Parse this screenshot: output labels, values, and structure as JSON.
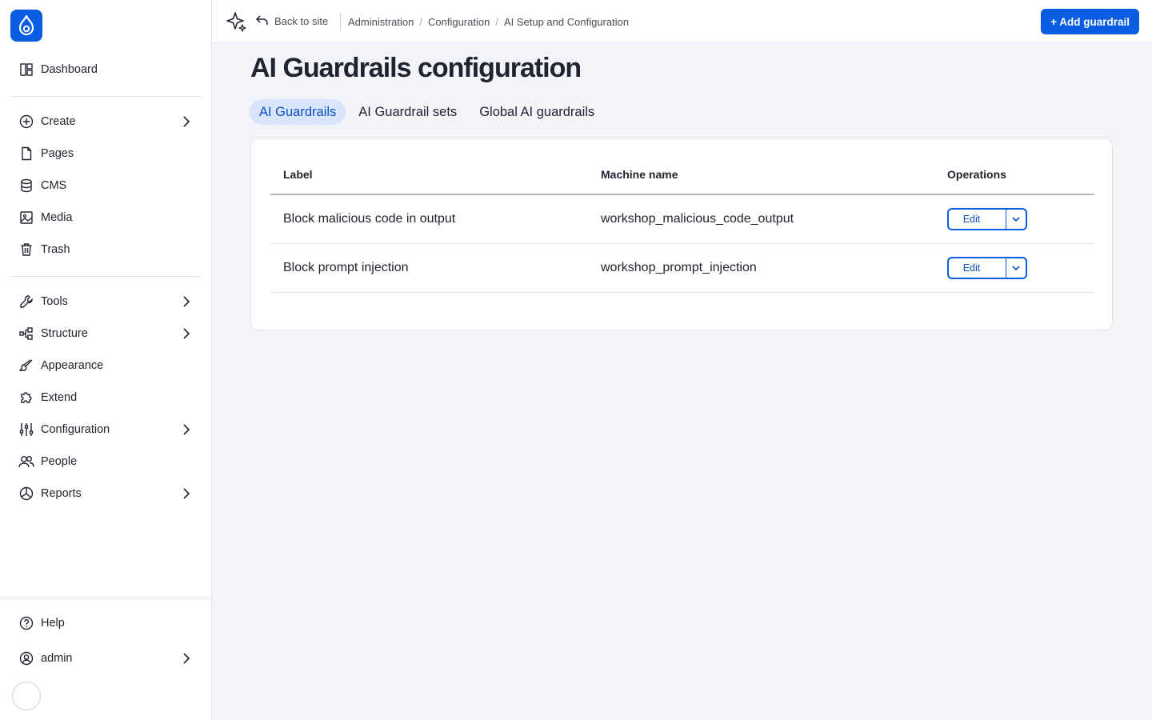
{
  "sidebar": {
    "top": [
      {
        "label": "Dashboard",
        "icon": "dashboard-icon"
      }
    ],
    "content": [
      {
        "label": "Create",
        "icon": "plus-circle-icon",
        "submenu": true
      },
      {
        "label": "Pages",
        "icon": "page-icon",
        "submenu": false
      },
      {
        "label": "CMS",
        "icon": "database-icon",
        "submenu": false
      },
      {
        "label": "Media",
        "icon": "image-icon",
        "submenu": false
      },
      {
        "label": "Trash",
        "icon": "trash-icon",
        "submenu": false
      }
    ],
    "admin": [
      {
        "label": "Tools",
        "icon": "wrench-icon",
        "submenu": true
      },
      {
        "label": "Structure",
        "icon": "structure-icon",
        "submenu": true
      },
      {
        "label": "Appearance",
        "icon": "brush-icon",
        "submenu": false
      },
      {
        "label": "Extend",
        "icon": "puzzle-icon",
        "submenu": false
      },
      {
        "label": "Configuration",
        "icon": "sliders-icon",
        "submenu": true
      },
      {
        "label": "People",
        "icon": "people-icon",
        "submenu": false
      },
      {
        "label": "Reports",
        "icon": "chart-pie-icon",
        "submenu": true
      }
    ],
    "bottom": [
      {
        "label": "Help",
        "icon": "help-icon",
        "submenu": false
      },
      {
        "label": "admin",
        "icon": "user-icon",
        "submenu": true
      }
    ]
  },
  "topbar": {
    "back_label": "Back to site",
    "breadcrumb": [
      "Administration",
      "Configuration",
      "AI Setup and Configuration"
    ],
    "add_button": "+ Add guardrail"
  },
  "page": {
    "title": "AI Guardrails configuration",
    "tabs": [
      "AI Guardrails",
      "AI Guardrail sets",
      "Global AI guardrails"
    ],
    "active_tab": 0
  },
  "table": {
    "headers": [
      "Label",
      "Machine name",
      "Operations"
    ],
    "rows": [
      {
        "label": "Block malicious code in output",
        "machine": "workshop_malicious_code_output",
        "op": "Edit"
      },
      {
        "label": "Block prompt injection",
        "machine": "workshop_prompt_injection",
        "op": "Edit"
      }
    ]
  },
  "colors": {
    "accent": "#0a5de0",
    "tab_active_bg": "#d9e5fb",
    "background": "#f3f4f9"
  }
}
